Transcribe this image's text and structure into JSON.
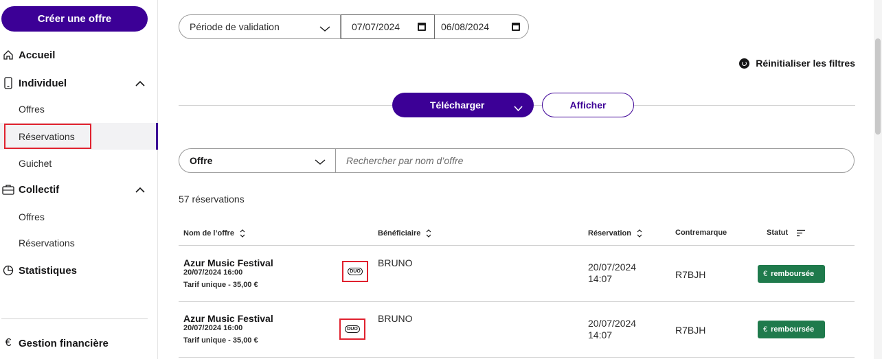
{
  "sidebar": {
    "create_button": "Créer une offre",
    "home": "Accueil",
    "individual": {
      "label": "Individuel",
      "items": [
        "Offres",
        "Réservations",
        "Guichet"
      ]
    },
    "collective": {
      "label": "Collectif",
      "items": [
        "Offres",
        "Réservations"
      ]
    },
    "stats": "Statistiques",
    "finance": "Gestion financière",
    "active_color": "#3c0096"
  },
  "filters": {
    "period_label": "Période de validation",
    "date_start": "07/07/2024",
    "date_end": "06/08/2024",
    "reset_label": "Réinitialiser les filtres"
  },
  "actions": {
    "download_label": "Télécharger",
    "show_label": "Afficher"
  },
  "search": {
    "type_label": "Offre",
    "placeholder": "Rechercher par nom d’offre"
  },
  "results": {
    "count_label": "57 réservations"
  },
  "table": {
    "headers": {
      "offer_name": "Nom de l’offre",
      "beneficiary": "Bénéficiaire",
      "booking": "Réservation",
      "token": "Contremarque",
      "status": "Statut"
    },
    "rows": [
      {
        "offer_name": "Azur Music Festival",
        "offer_date": "20/07/2024 16:00",
        "price": "Tarif unique - 35,00 €",
        "duo": "DUO",
        "beneficiary": "BRUNO",
        "booking_date": "20/07/2024",
        "booking_time": "14:07",
        "token": "R7BJH",
        "status": "remboursée"
      },
      {
        "offer_name": "Azur Music Festival",
        "offer_date": "20/07/2024 16:00",
        "price": "Tarif unique - 35,00 €",
        "duo": "DUO",
        "beneficiary": "BRUNO",
        "booking_date": "20/07/2024",
        "booking_time": "14:07",
        "token": "R7BJH",
        "status": "remboursée"
      }
    ]
  },
  "colors": {
    "brand": "#3c0096",
    "success": "#1f7a4c",
    "highlight": "#e0212e"
  }
}
